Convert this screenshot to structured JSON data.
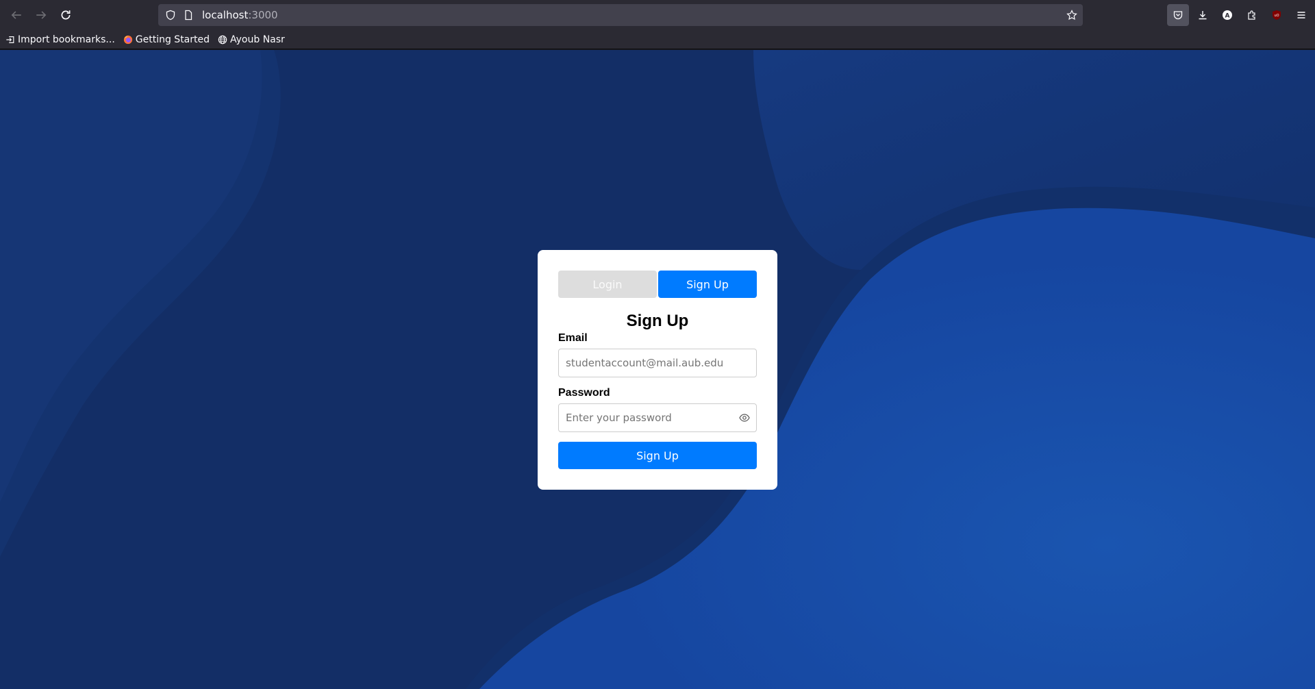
{
  "browser": {
    "url_host": "localhost",
    "url_port": ":3000",
    "bookmarks": [
      {
        "label": "Import bookmarks...",
        "icon": "import-icon"
      },
      {
        "label": "Getting Started",
        "icon": "firefox-icon"
      },
      {
        "label": "Ayoub Nasr",
        "icon": "globe-icon"
      }
    ],
    "extension_letter": "A",
    "ublock_label": "uO"
  },
  "auth": {
    "tabs": [
      {
        "label": "Login",
        "active": false
      },
      {
        "label": "Sign Up",
        "active": true
      }
    ],
    "title": "Sign Up",
    "email_label": "Email",
    "email_placeholder": "studentaccount@mail.aub.edu",
    "password_label": "Password",
    "password_placeholder": "Enter your password",
    "submit_label": "Sign Up"
  },
  "colors": {
    "primary": "#007bff",
    "inactive_tab": "#dddddd",
    "background": "#132e66"
  }
}
